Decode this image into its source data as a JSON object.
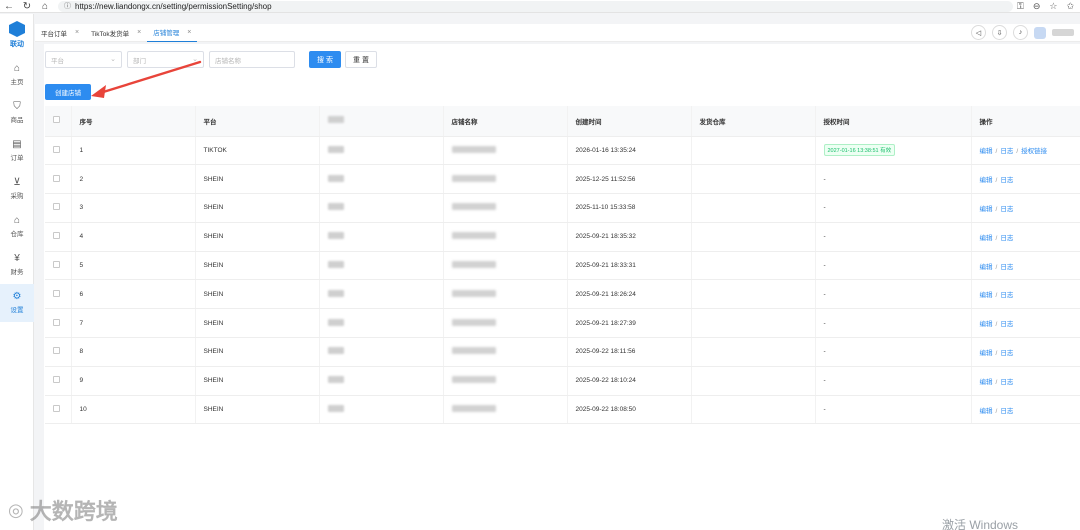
{
  "browser": {
    "url": "https://new.liandongx.cn/setting/permissionSetting/shop"
  },
  "sidebar": {
    "logo_text": "联动",
    "items": [
      {
        "label": "主页",
        "icon": "home-icon"
      },
      {
        "label": "商品",
        "icon": "bag-icon"
      },
      {
        "label": "订单",
        "icon": "file-icon"
      },
      {
        "label": "采购",
        "icon": "cart-icon"
      },
      {
        "label": "仓库",
        "icon": "warehouse-icon"
      },
      {
        "label": "财务",
        "icon": "yen-icon"
      },
      {
        "label": "设置",
        "icon": "gear-icon",
        "active": true
      }
    ]
  },
  "tabs": [
    {
      "label": "平台订单"
    },
    {
      "label": "TikTok发货单"
    },
    {
      "label": "店铺管理",
      "active": true
    }
  ],
  "filters": {
    "platform_placeholder": "平台",
    "department_placeholder": "部门",
    "shop_placeholder": "店铺名称",
    "search_label": "搜 索",
    "reset_label": "重 置"
  },
  "create_button_label": "创建店铺",
  "table": {
    "headers": {
      "index": "序号",
      "platform": "平台",
      "shop_name": "店铺名称",
      "created": "创建时间",
      "warehouse": "发货仓库",
      "auth_time": "授权时间",
      "actions": "操作"
    },
    "rows": [
      {
        "index": "1",
        "platform": "TIKTOK",
        "created": "2026-01-16 13:35:24",
        "auth": "2027-01-16 13:38:51 有效",
        "ops": [
          "编辑",
          "日志",
          "授权链接"
        ]
      },
      {
        "index": "2",
        "platform": "SHEIN",
        "created": "2025-12-25 11:52:56",
        "auth": "-",
        "ops": [
          "编辑",
          "日志"
        ]
      },
      {
        "index": "3",
        "platform": "SHEIN",
        "created": "2025-11-10 15:33:58",
        "auth": "-",
        "ops": [
          "编辑",
          "日志"
        ]
      },
      {
        "index": "4",
        "platform": "SHEIN",
        "created": "2025-09-21 18:35:32",
        "auth": "-",
        "ops": [
          "编辑",
          "日志"
        ]
      },
      {
        "index": "5",
        "platform": "SHEIN",
        "created": "2025-09-21 18:33:31",
        "auth": "-",
        "ops": [
          "编辑",
          "日志"
        ]
      },
      {
        "index": "6",
        "platform": "SHEIN",
        "created": "2025-09-21 18:26:24",
        "auth": "-",
        "ops": [
          "编辑",
          "日志"
        ]
      },
      {
        "index": "7",
        "platform": "SHEIN",
        "created": "2025-09-21 18:27:39",
        "auth": "-",
        "ops": [
          "编辑",
          "日志"
        ]
      },
      {
        "index": "8",
        "platform": "SHEIN",
        "created": "2025-09-22 18:11:56",
        "auth": "-",
        "ops": [
          "编辑",
          "日志"
        ]
      },
      {
        "index": "9",
        "platform": "SHEIN",
        "created": "2025-09-22 18:10:24",
        "auth": "-",
        "ops": [
          "编辑",
          "日志"
        ]
      },
      {
        "index": "10",
        "platform": "SHEIN",
        "created": "2025-09-22 18:08:50",
        "auth": "-",
        "ops": [
          "编辑",
          "日志"
        ]
      }
    ]
  },
  "watermarks": {
    "left": "大数跨境",
    "right": "激活 Windows"
  },
  "colors": {
    "primary": "#2d8cf0",
    "annotation_arrow": "#e8443a",
    "auth_valid": "#19be6b"
  }
}
